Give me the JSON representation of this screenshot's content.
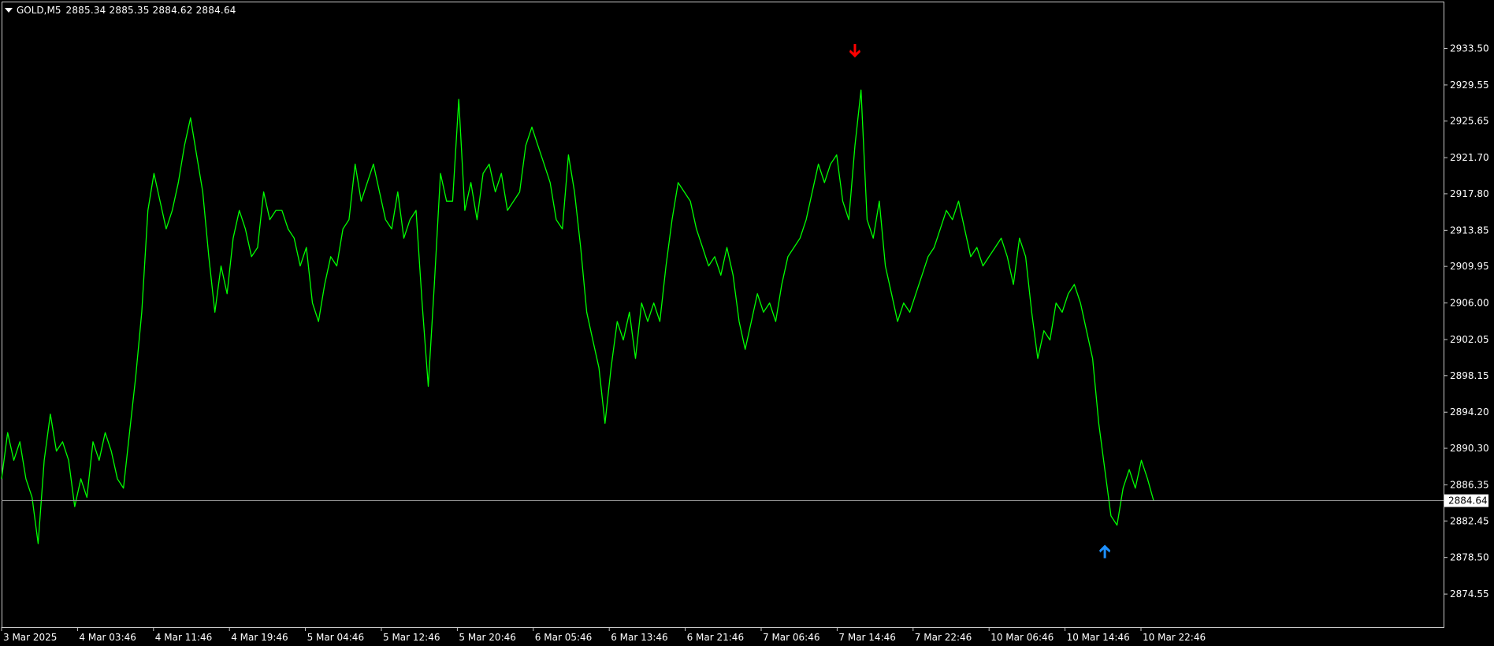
{
  "header": {
    "symbol": "GOLD,M5",
    "ohlc": "2885.34 2885.35 2884.62 2884.64"
  },
  "colors": {
    "background": "#000000",
    "price_line": "#00ff00",
    "frame": "#c8c8c8",
    "current_price_line": "#9a9a9a",
    "sell_arrow": "#ff0000",
    "buy_arrow": "#1e90ff",
    "label_text": "#ffffff"
  },
  "chart_data": {
    "type": "line",
    "title": "",
    "xlabel": "",
    "ylabel": "",
    "ylim": [
      2872.6,
      2937.2
    ],
    "grid": false,
    "y_ticks": [
      "2933.50",
      "2929.55",
      "2925.65",
      "2921.70",
      "2917.80",
      "2913.85",
      "2909.95",
      "2906.00",
      "2902.05",
      "2898.15",
      "2894.20",
      "2890.30",
      "2886.35",
      "2882.45",
      "2878.50",
      "2874.55"
    ],
    "x_ticks": [
      "3 Mar 2025",
      "4 Mar 03:46",
      "4 Mar 11:46",
      "4 Mar 19:46",
      "5 Mar 04:46",
      "5 Mar 12:46",
      "5 Mar 20:46",
      "6 Mar 05:46",
      "6 Mar 13:46",
      "6 Mar 21:46",
      "7 Mar 06:46",
      "7 Mar 14:46",
      "7 Mar 22:46",
      "10 Mar 06:46",
      "10 Mar 14:46",
      "10 Mar 22:46"
    ],
    "current_price": "2884.64",
    "current_price_value": 2884.64,
    "series": [
      {
        "values": [
          2887,
          2892,
          2889,
          2891,
          2887,
          2885,
          2880,
          2889,
          2894,
          2890,
          2891,
          2889,
          2884,
          2887,
          2885,
          2891,
          2889,
          2892,
          2890,
          2887,
          2886,
          2892,
          2898,
          2905,
          2916,
          2920,
          2917,
          2914,
          2916,
          2919,
          2923,
          2926,
          2922,
          2918,
          2911,
          2905,
          2910,
          2907,
          2913,
          2916,
          2914,
          2911,
          2912,
          2918,
          2915,
          2916,
          2916,
          2914,
          2913,
          2910,
          2912,
          2906,
          2904,
          2908,
          2911,
          2910,
          2914,
          2915,
          2921,
          2917,
          2919,
          2921,
          2918,
          2915,
          2914,
          2918,
          2913,
          2915,
          2916,
          2906,
          2897,
          2908,
          2920,
          2917,
          2917,
          2928,
          2916,
          2919,
          2915,
          2920,
          2921,
          2918,
          2920,
          2916,
          2917,
          2918,
          2923,
          2925,
          2923,
          2921,
          2919,
          2915,
          2914,
          2922,
          2918,
          2912,
          2905,
          2902,
          2899,
          2893,
          2899,
          2904,
          2902,
          2905,
          2900,
          2906,
          2904,
          2906,
          2904,
          2910,
          2915,
          2919,
          2918,
          2917,
          2914,
          2912,
          2910,
          2911,
          2909,
          2912,
          2909,
          2904,
          2901,
          2904,
          2907,
          2905,
          2906,
          2904,
          2908,
          2911,
          2912,
          2913,
          2915,
          2918,
          2921,
          2919,
          2921,
          2922,
          2917,
          2915,
          2923,
          2929,
          2915,
          2913,
          2917,
          2910,
          2907,
          2904,
          2906,
          2905,
          2907,
          2909,
          2911,
          2912,
          2914,
          2916,
          2915,
          2917,
          2914,
          2911,
          2912,
          2910,
          2911,
          2912,
          2913,
          2911,
          2908,
          2913,
          2911,
          2905,
          2900,
          2903,
          2902,
          2906,
          2905,
          2907,
          2908,
          2906,
          2903,
          2900,
          2893,
          2888,
          2883,
          2882,
          2886,
          2888,
          2886,
          2889,
          2887,
          2884.64
        ]
      }
    ],
    "signals": [
      {
        "type": "sell",
        "index": 140,
        "price": 2933.2
      },
      {
        "type": "buy",
        "index": 181,
        "price": 2879.2
      }
    ]
  }
}
